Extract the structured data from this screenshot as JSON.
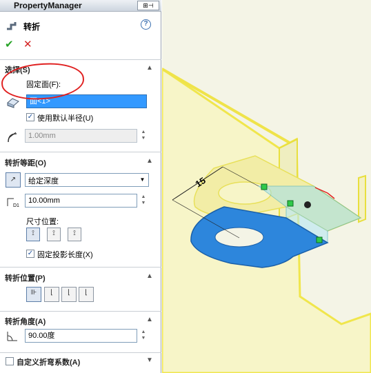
{
  "panel": {
    "header": "PropertyManager",
    "feature": "转折",
    "help": "?",
    "ok": "✔",
    "cancel": "✕",
    "selection": {
      "header": "选择(S)",
      "fixed_face_label": "固定面(F):",
      "fixed_face_value": "面<1>",
      "use_default_radius": "使用默认半径(U)",
      "radius_value": "1.00mm"
    },
    "offset": {
      "header": "转折等距(O)",
      "end_condition": "给定深度",
      "distance": "10.00mm",
      "dim_position_label": "尺寸位置:",
      "fixed_projected_length": "固定投影长度(X)"
    },
    "position": {
      "header": "转折位置(P)"
    },
    "angle": {
      "header": "转折角度(A)",
      "value": "90.00度"
    },
    "custom": {
      "header": "自定义折弯系数(A)"
    }
  },
  "view": {
    "dimension_label": "15"
  }
}
